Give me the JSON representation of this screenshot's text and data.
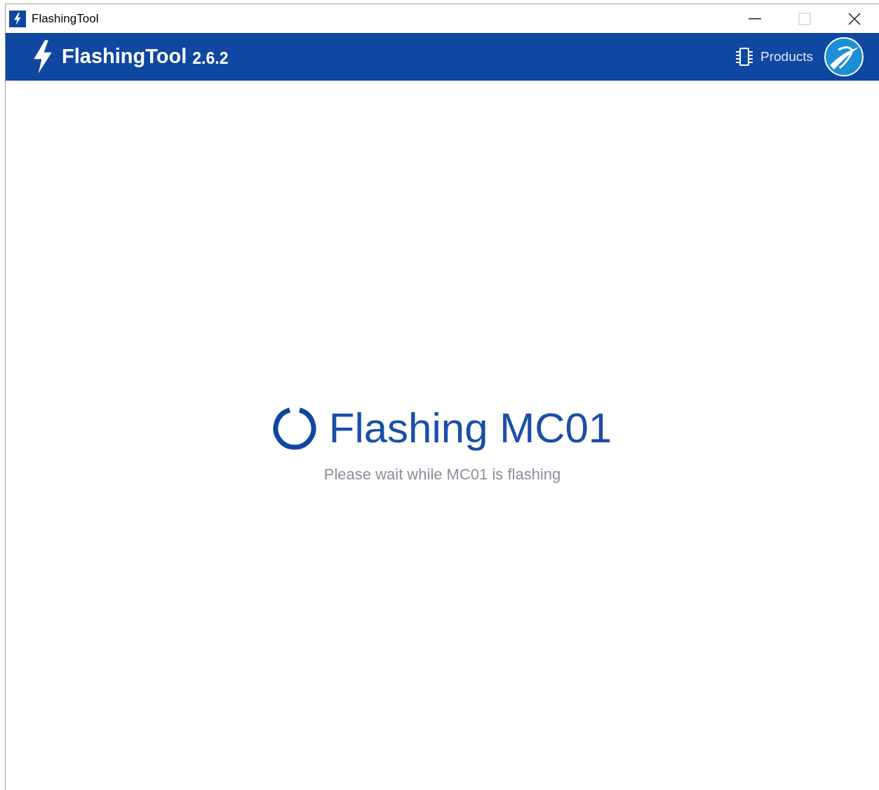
{
  "window": {
    "title": "FlashingTool",
    "maximize_disabled": true
  },
  "header": {
    "app_name": "FlashingTool",
    "version": "2.6.2",
    "products_link": "Products"
  },
  "status": {
    "title": "Flashing MC01",
    "message": "Please wait while MC01 is flashing"
  }
}
